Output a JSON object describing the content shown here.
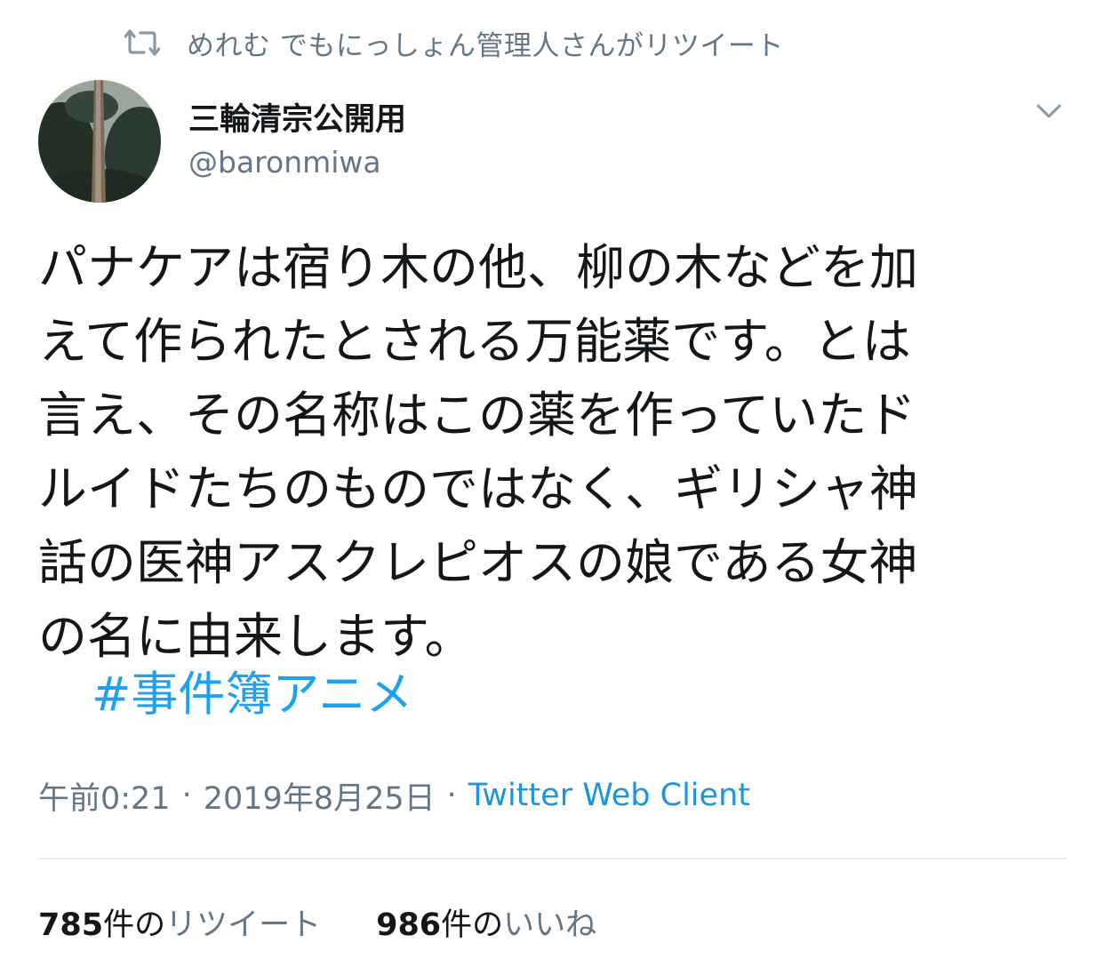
{
  "retweet_context": {
    "icon": "retweet-icon",
    "text": "めれむ でもにっしょん管理人さんがリツイート"
  },
  "author": {
    "display_name": "三輪清宗公開用",
    "handle": "@baronmiwa"
  },
  "tweet": {
    "lines": [
      "パナケアは宿り木の他、柳の木などを加",
      "えて作られたとされる万能薬です。とは",
      "言え、その名称はこの薬を作っていたド",
      "ルイドたちのものではなく、ギリシャ神",
      "話の医神アスクレピオスの娘である女神",
      "の名に由来します。"
    ],
    "hashtag": "#事件簿アニメ"
  },
  "meta": {
    "time": "午前0:21",
    "separator": "·",
    "date": "2019年8月25日",
    "source": "Twitter Web Client"
  },
  "stats": {
    "retweets": {
      "count": "785",
      "suffix": "件の",
      "label": "リツイート"
    },
    "likes": {
      "count": "986",
      "suffix": "件の",
      "label": "いいね"
    }
  },
  "colors": {
    "text": "#14171a",
    "secondary": "#657786",
    "link": "#1da1f2",
    "divider": "#e6ecf0"
  }
}
